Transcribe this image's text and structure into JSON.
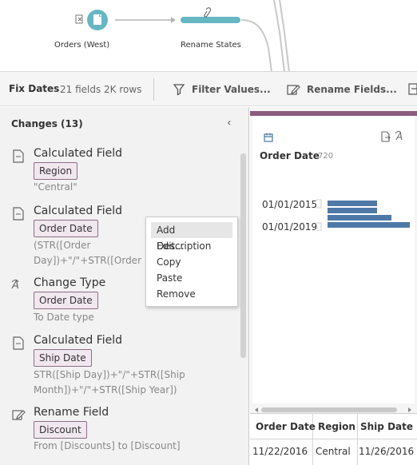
{
  "flow": {
    "node1_label": "Orders (West)",
    "node2_label": "Rename States"
  },
  "toolbar": {
    "title": "Fix Dates",
    "fields": "21 fields",
    "rows": "2K rows",
    "filter_label": "Filter Values...",
    "rename_label": "Rename Fields..."
  },
  "changes": {
    "header": "Changes (13)",
    "items": [
      {
        "icon": "calculated-field-icon",
        "title": "Calculated Field",
        "field": "Region",
        "desc": "\"Central\""
      },
      {
        "icon": "calculated-field-icon",
        "title": "Calculated Field",
        "field": "Order Date",
        "desc_lines": [
          "(STR([Order",
          "Day])+\"/\"+STR([Order"
        ]
      },
      {
        "icon": "change-type-icon",
        "title": "Change Type",
        "field": "Order Date",
        "desc": "To Date type"
      },
      {
        "icon": "calculated-field-icon",
        "title": "Calculated Field",
        "field": "Ship Date",
        "desc_lines": [
          "STR([Ship Day])+\"/\"+STR([Ship",
          "Month])+\"/\"+STR([Ship Year])"
        ]
      },
      {
        "icon": "rename-field-icon",
        "title": "Rename Field",
        "field": "Discount",
        "desc": "From [Discounts] to [Discount]"
      }
    ]
  },
  "context_menu": {
    "items": [
      "Add Description",
      "Edit...",
      "Copy",
      "Paste",
      "Remove"
    ],
    "active_index": 0
  },
  "profile": {
    "field_name": "Order Date",
    "count": "720",
    "labels": [
      "01/01/2015",
      "01/01/2019"
    ],
    "bar_color": "#4e79a7",
    "accent_color": "#8c5b7e"
  },
  "chart_data": {
    "type": "bar",
    "orientation": "horizontal",
    "categories": [
      "01/01/2015",
      "",
      "",
      "01/01/2019"
    ],
    "values": [
      62,
      62,
      80,
      103
    ]
  },
  "grid": {
    "headers": [
      "Order Date",
      "Region",
      "Ship Date"
    ],
    "rows": [
      [
        "11/22/2016",
        "Central",
        "11/26/2016"
      ]
    ]
  }
}
